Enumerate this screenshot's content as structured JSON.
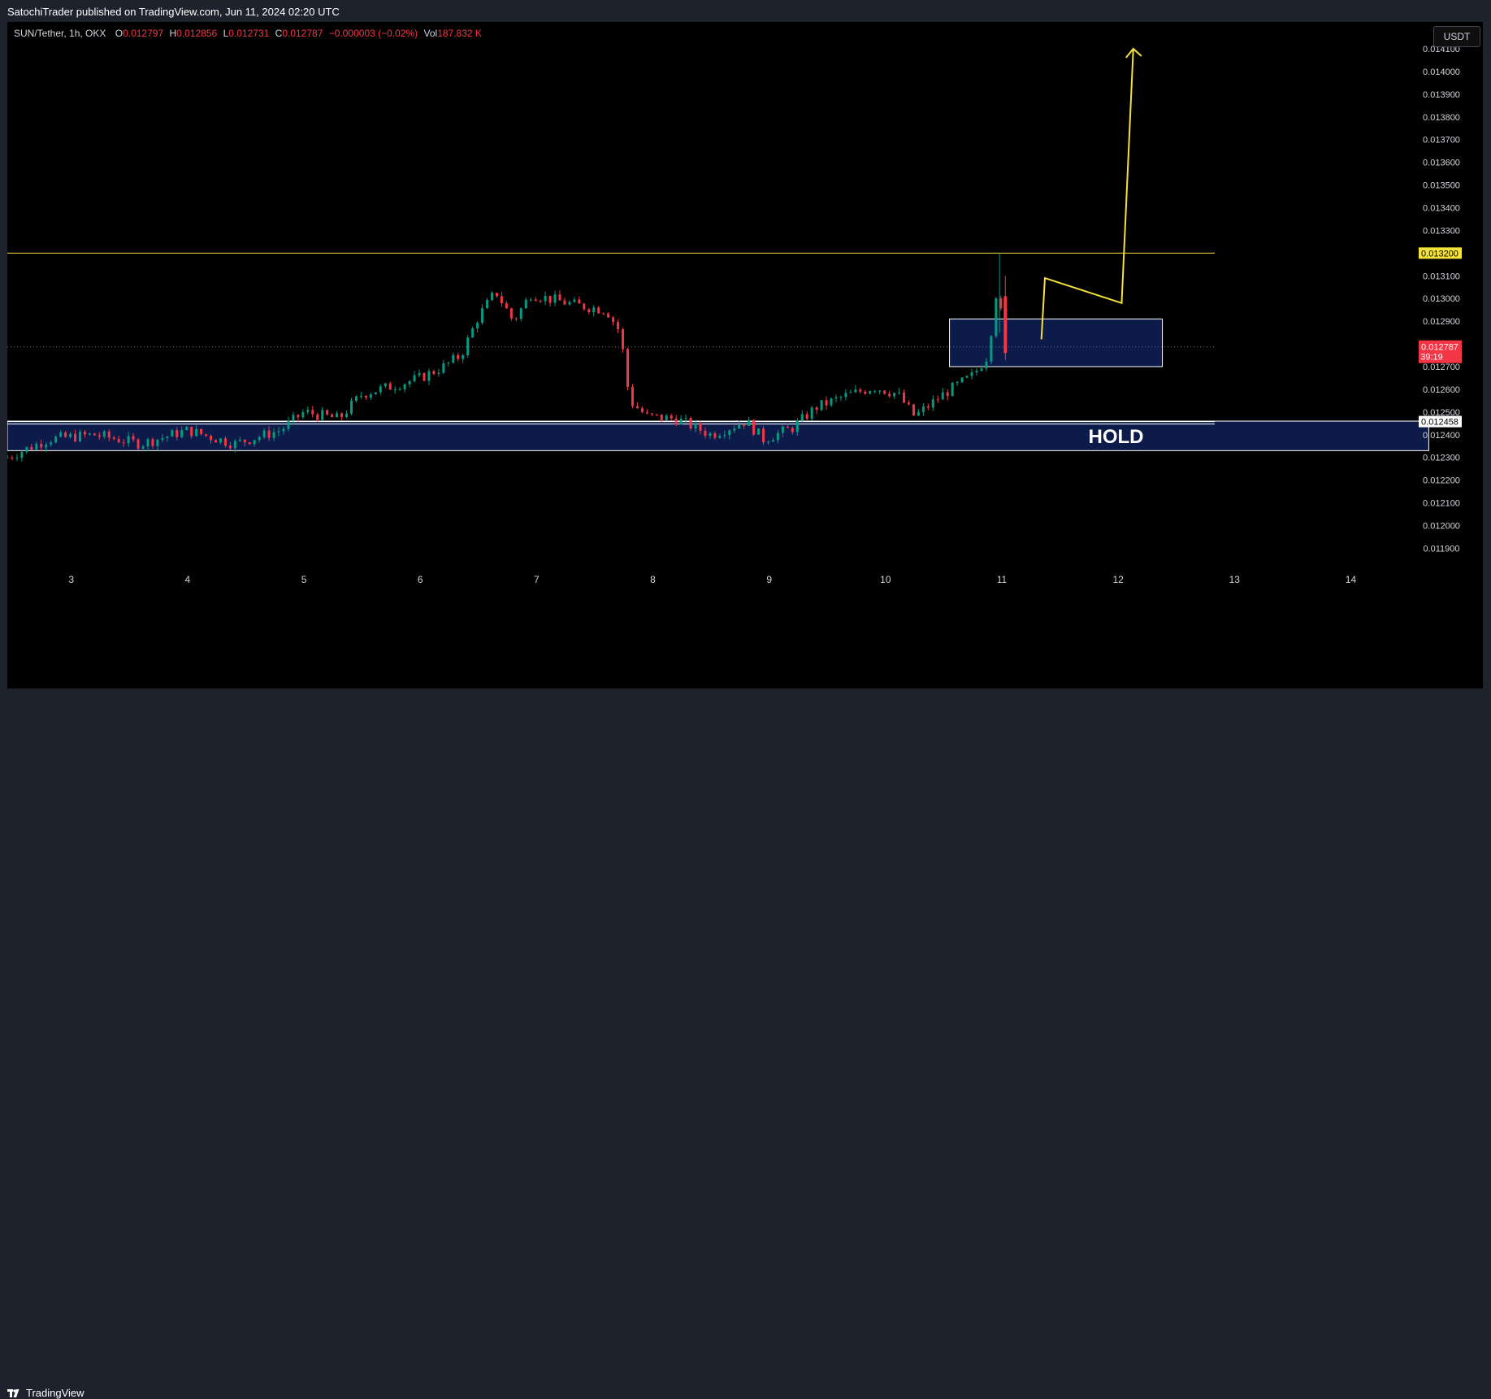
{
  "header": {
    "published": "SatochiTrader published on TradingView.com, Jun 11, 2024 02:20 UTC"
  },
  "legend": {
    "symbol": "SUN/Tether, 1h, OKX",
    "o_label": "O",
    "o_value": "0.012797",
    "h_label": "H",
    "h_value": "0.012856",
    "l_label": "L",
    "l_value": "0.012731",
    "c_label": "C",
    "c_value": "0.012787",
    "change": "−0.000003 (−0.02%)",
    "vol_label": "Vol",
    "vol_value": "187.832 K"
  },
  "currency_button": "USDT",
  "footer": {
    "logo_text": "TradingView",
    "logo_icon": "tradingview-logo-icon"
  },
  "colors": {
    "background": "#000000",
    "up": "#089981",
    "down": "#f23645",
    "annotation": "#f5e23a",
    "zone_fill": "#0d1b4a",
    "axis_text": "#d1d4dc"
  },
  "chart_data": {
    "type": "candlestick",
    "symbol": "SUN/Tether",
    "interval": "1h",
    "exchange": "OKX",
    "x_ticks": [
      "3",
      "4",
      "5",
      "6",
      "7",
      "8",
      "9",
      "10",
      "11",
      "12",
      "13",
      "14"
    ],
    "y_ticks": [
      "0.014100",
      "0.014000",
      "0.013900",
      "0.013800",
      "0.013700",
      "0.013600",
      "0.013500",
      "0.013400",
      "0.013300",
      "0.013100",
      "0.013000",
      "0.012900",
      "0.012700",
      "0.012600",
      "0.012500",
      "0.012400",
      "0.012300",
      "0.012200",
      "0.012100",
      "0.012000",
      "0.011900"
    ],
    "ylim": [
      0.01183,
      0.01415
    ],
    "xlim": [
      2.45,
      14.8
    ],
    "horizontal_lines": [
      {
        "price": 0.0132,
        "label": "0.013200",
        "color": "#f5e23a"
      },
      {
        "price": 0.012458,
        "label": "0.012458",
        "color": "#ffffff"
      }
    ],
    "last_price": {
      "price": 0.012787,
      "label": "0.012787",
      "countdown": "39:19",
      "color": "#f23645"
    },
    "zones": [
      {
        "x0": 2.45,
        "x1": 14.67,
        "y0": 0.01233,
        "y1": 0.01246,
        "text": "HOLD"
      },
      {
        "x0": 10.55,
        "x1": 12.38,
        "y0": 0.0127,
        "y1": 0.01291,
        "text": ""
      }
    ],
    "projection_path": [
      [
        11.34,
        0.01282
      ],
      [
        11.37,
        0.01309
      ],
      [
        12.03,
        0.01298
      ],
      [
        12.13,
        0.0141
      ]
    ],
    "candle_keypoints": [
      [
        2.45,
        0.0123
      ],
      [
        2.8,
        0.01238
      ],
      [
        3.2,
        0.0124
      ],
      [
        3.6,
        0.01236
      ],
      [
        4.0,
        0.01242
      ],
      [
        4.4,
        0.01236
      ],
      [
        4.8,
        0.01242
      ],
      [
        5.0,
        0.0125
      ],
      [
        5.3,
        0.01247
      ],
      [
        5.5,
        0.01258
      ],
      [
        5.8,
        0.01262
      ],
      [
        6.0,
        0.01265
      ],
      [
        6.2,
        0.0127
      ],
      [
        6.35,
        0.01275
      ],
      [
        6.5,
        0.01292
      ],
      [
        6.65,
        0.01303
      ],
      [
        6.8,
        0.0129
      ],
      [
        6.95,
        0.01302
      ],
      [
        7.1,
        0.013
      ],
      [
        7.35,
        0.01297
      ],
      [
        7.6,
        0.01295
      ],
      [
        7.72,
        0.01285
      ],
      [
        7.8,
        0.01255
      ],
      [
        7.95,
        0.01248
      ],
      [
        8.2,
        0.01247
      ],
      [
        8.5,
        0.0124
      ],
      [
        8.8,
        0.01246
      ],
      [
        8.95,
        0.01238
      ],
      [
        9.2,
        0.01243
      ],
      [
        9.4,
        0.01252
      ],
      [
        9.65,
        0.01257
      ],
      [
        9.9,
        0.01261
      ],
      [
        10.1,
        0.01258
      ],
      [
        10.25,
        0.01248
      ],
      [
        10.5,
        0.01258
      ],
      [
        10.75,
        0.01266
      ],
      [
        10.88,
        0.01275
      ],
      [
        10.95,
        0.01302
      ],
      [
        11.05,
        0.01282
      ]
    ]
  }
}
